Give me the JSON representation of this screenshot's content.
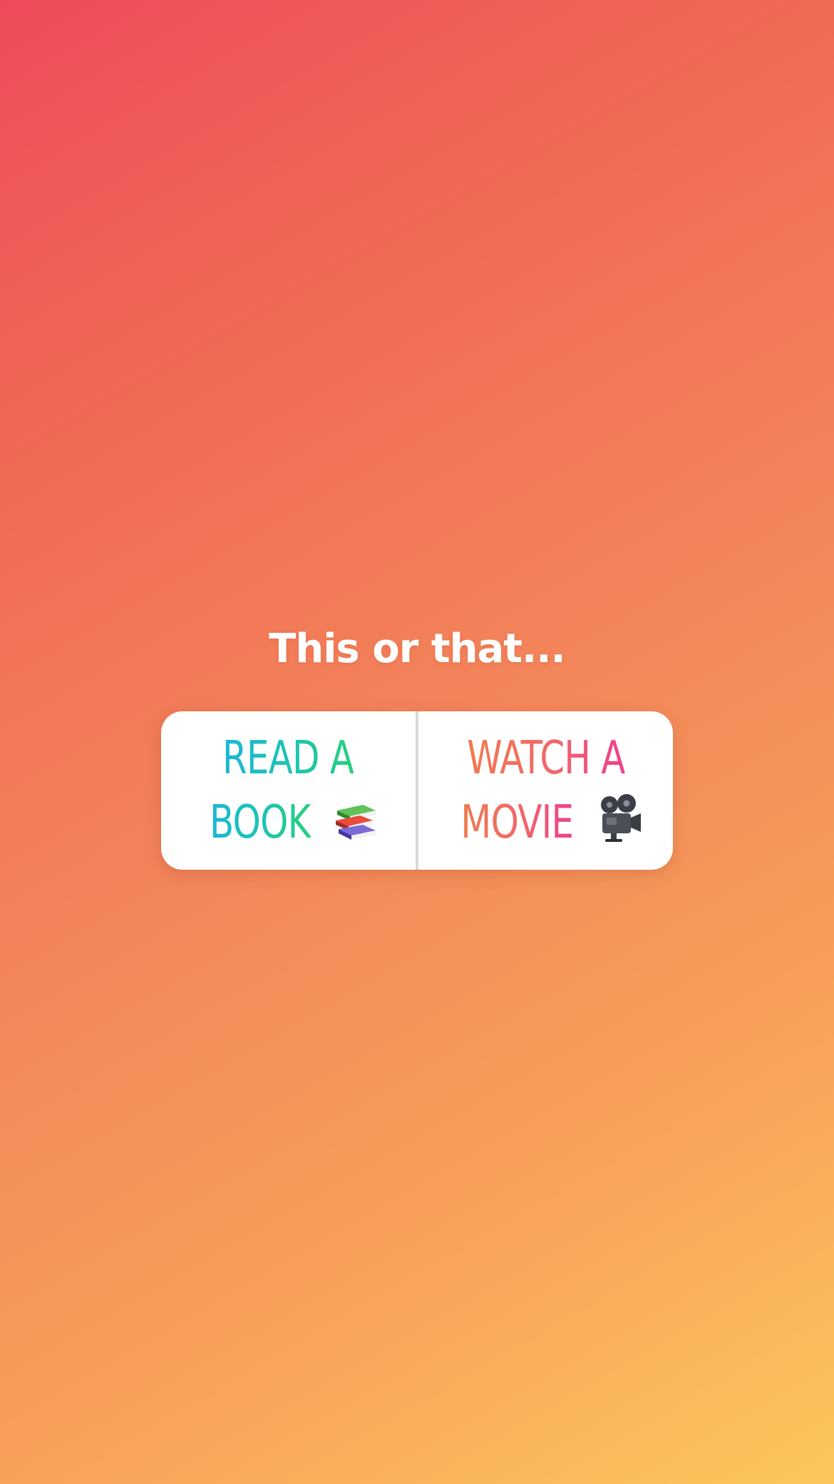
{
  "story": {
    "prompt": "This or that..."
  },
  "poll": {
    "left_option": {
      "line1": "READ A",
      "line2": "BOOK",
      "icon": "books-icon"
    },
    "right_option": {
      "line1": "WATCH A",
      "line2": "MOVIE",
      "icon": "movie-camera-icon"
    }
  },
  "colors": {
    "background_start": "#ee4b5a",
    "background_end": "#fdc65b",
    "left_text_gradient": [
      "#1bb7d6",
      "#27d07a"
    ],
    "right_text_gradient": [
      "#f07a50",
      "#ee3f8d"
    ]
  }
}
